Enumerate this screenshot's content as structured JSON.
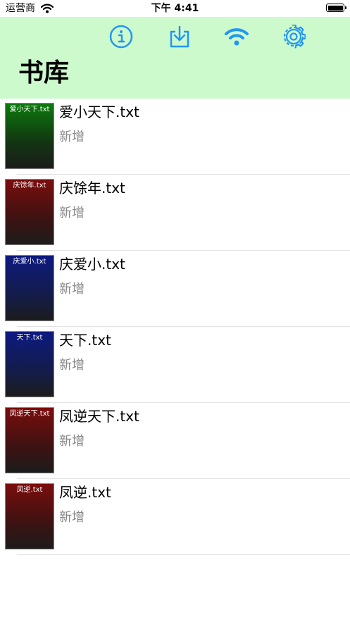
{
  "status_bar": {
    "carrier": "运营商",
    "time": "下午 4:41"
  },
  "nav": {
    "title": "书库",
    "icons": [
      "info-icon",
      "download-icon",
      "wifi-icon",
      "gear-icon"
    ],
    "accent_color": "#2196f3",
    "background_color": "#cdfacd"
  },
  "books": [
    {
      "cover_title": "爱小天下.txt",
      "title": "爱小天下.txt",
      "status": "新增",
      "cover_color": "green"
    },
    {
      "cover_title": "庆馀年.txt",
      "title": "庆馀年.txt",
      "status": "新增",
      "cover_color": "red"
    },
    {
      "cover_title": "庆爱小.txt",
      "title": "庆爱小.txt",
      "status": "新增",
      "cover_color": "blue"
    },
    {
      "cover_title": "天下.txt",
      "title": "天下.txt",
      "status": "新增",
      "cover_color": "blue"
    },
    {
      "cover_title": "凤逆天下.txt",
      "title": "凤逆天下.txt",
      "status": "新增",
      "cover_color": "red"
    },
    {
      "cover_title": "凤逆.txt",
      "title": "凤逆.txt",
      "status": "新增",
      "cover_color": "red"
    }
  ]
}
